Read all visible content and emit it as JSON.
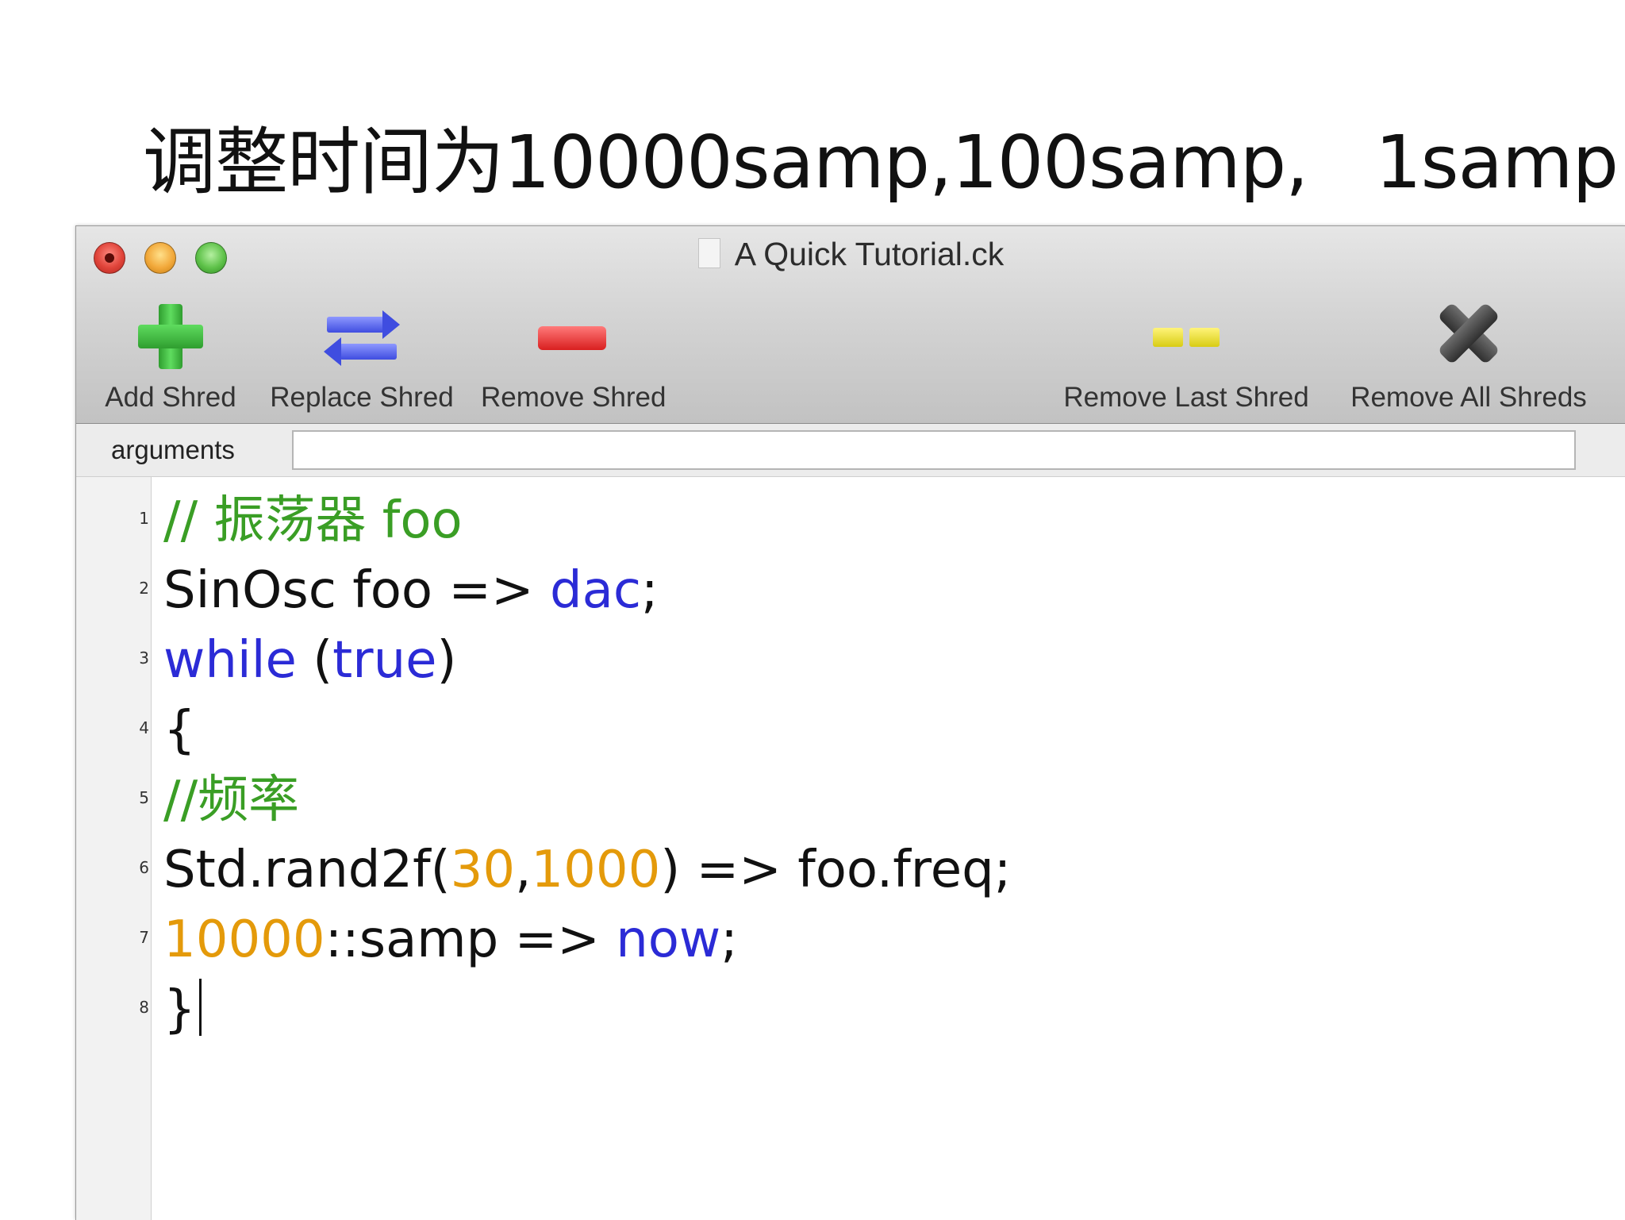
{
  "slide": {
    "title": "调整时间为10000samp,100samp,   1samp"
  },
  "window": {
    "title": "A Quick Tutorial.ck"
  },
  "toolbar": {
    "add_shred": "Add Shred",
    "replace_shred": "Replace Shred",
    "remove_shred": "Remove Shred",
    "remove_last_shred": "Remove Last Shred",
    "remove_all_shreds": "Remove All Shreds"
  },
  "arguments": {
    "label": "arguments",
    "value": ""
  },
  "colors": {
    "comment": "#3a9e25",
    "keyword": "#2b2bd6",
    "number": "#e49a0a",
    "text": "#111111"
  },
  "code": {
    "lines": [
      {
        "number": "1",
        "t1": "// 振荡器 foo"
      },
      {
        "number": "2",
        "t1": "SinOsc foo => ",
        "t2": "dac",
        "t3": ";"
      },
      {
        "number": "3",
        "t1": "while",
        "t2": " (",
        "t3": "true",
        "t4": ")"
      },
      {
        "number": "4",
        "t1": "{"
      },
      {
        "number": "5",
        "t1": "//频率"
      },
      {
        "number": "6",
        "t1": "Std.rand2f(",
        "t2": "30",
        "t3": ",",
        "t4": "1000",
        "t5": ") => foo.freq;"
      },
      {
        "number": "7",
        "t1": "10000",
        "t2": "::samp => ",
        "t3": "now",
        "t4": ";"
      },
      {
        "number": "8",
        "t1": "}"
      }
    ]
  }
}
